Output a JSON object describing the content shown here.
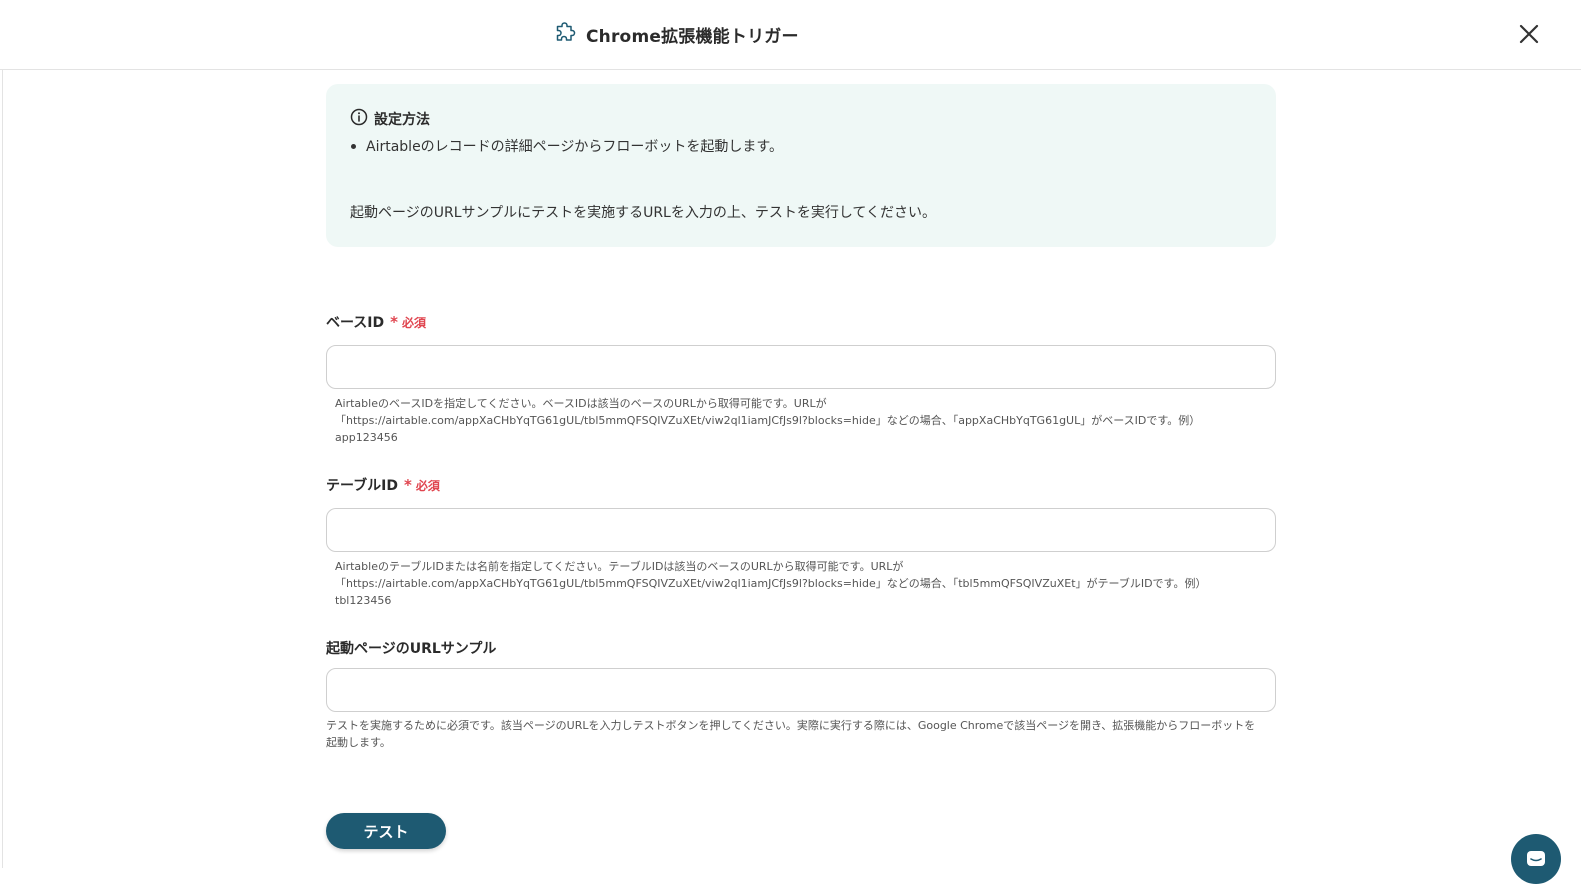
{
  "header": {
    "title": "Chrome拡張機能トリガー",
    "icon": "puzzle-icon",
    "close_icon": "close-icon"
  },
  "info": {
    "heading": "設定方法",
    "bullet": "Airtableのレコードの詳細ページからフローボットを起動します。",
    "note": "起動ページのURLサンプルにテストを実施するURLを入力の上、テストを実行してください。"
  },
  "fields": [
    {
      "label": "ベースID",
      "required_mark": "*",
      "required_text": "必須",
      "value": "",
      "help": [
        "AirtableのベースIDを指定してください。ベースIDは該当のベースのURLから取得可能です。URLが",
        "「https://airtable.com/appXaCHbYqTG61gUL/tbl5mmQFSQIVZuXEt/viw2ql1iamJCfJs9l?blocks=hide」などの場合、「appXaCHbYqTG61gUL」がベースIDです。例）",
        "app123456"
      ]
    },
    {
      "label": "テーブルID",
      "required_mark": "*",
      "required_text": "必須",
      "value": "",
      "help": [
        "AirtableのテーブルIDまたは名前を指定してください。テーブルIDは該当のベースのURLから取得可能です。URLが",
        "「https://airtable.com/appXaCHbYqTG61gUL/tbl5mmQFSQIVZuXEt/viw2ql1iamJCfJs9l?blocks=hide」などの場合、「tbl5mmQFSQIVZuXEt」がテーブルIDです。例）",
        "tbl123456"
      ]
    },
    {
      "label": "起動ページのURLサンプル",
      "value": "",
      "help": [
        "テストを実施するために必須です。該当ページのURLを入力しテストボタンを押してください。実際に実行する際には、Google Chromeで該当ページを開き、拡張機能からフローボットを",
        "起動します。"
      ]
    }
  ],
  "test_button": {
    "label": "テスト"
  },
  "colors": {
    "accent": "#1e5a72",
    "info_bg": "#eff8f6",
    "required": "#e0454f"
  },
  "chat_widget": {
    "icon": "chat-icon"
  }
}
